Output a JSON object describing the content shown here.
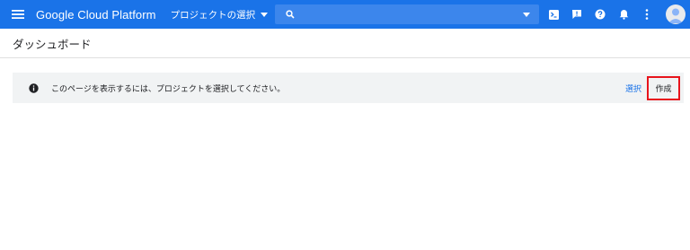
{
  "header": {
    "brand": "Google Cloud Platform",
    "project_picker_label": "プロジェクトの選択",
    "search_placeholder": ""
  },
  "icons": {
    "menu": "hamburger-menu-icon",
    "search": "search-icon",
    "cloud_shell": "cloud-shell-icon",
    "feedback": "feedback-icon",
    "help": "help-icon",
    "notifications": "bell-icon",
    "more": "more-vert-icon",
    "account": "avatar-icon",
    "info": "info-icon"
  },
  "page": {
    "title": "ダッシュボード"
  },
  "banner": {
    "message": "このページを表示するには、プロジェクトを選択してください。",
    "select_label": "選択",
    "create_label": "作成"
  },
  "colors": {
    "topbar": "#1a73e8",
    "search_bg": "#3c86ec",
    "banner_bg": "#f1f3f4",
    "link": "#1a73e8",
    "highlight": "#e8141c"
  }
}
